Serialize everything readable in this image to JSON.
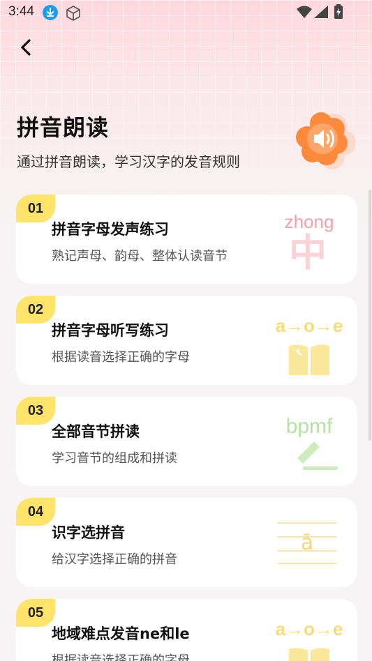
{
  "status_bar": {
    "time": "3:44"
  },
  "header": {
    "title": "拼音朗读",
    "subtitle": "通过拼音朗读，学习汉字的发音规则"
  },
  "cards": [
    {
      "number": "01",
      "title": "拼音字母发声练习",
      "desc": "熟记声母、韵母、整体认读音节",
      "art_word": "zhong",
      "art_char": "中"
    },
    {
      "number": "02",
      "title": "拼音字母听写练习",
      "desc": "根据读音选择正确的字母",
      "art_word": "a→o→e"
    },
    {
      "number": "03",
      "title": "全部音节拼读",
      "desc": "学习音节的组成和拼读",
      "art_word": "bpmf"
    },
    {
      "number": "04",
      "title": "识字选拼音",
      "desc": "给汉字选择正确的拼音",
      "art_word": "ā"
    },
    {
      "number": "05",
      "title": "地域难点发音ne和le",
      "desc": "根据读音选择正确的字母",
      "art_word": "a→o→e"
    }
  ],
  "colors": {
    "accent_yellow": "#ffe36b",
    "card_bg": "#ffffff",
    "speaker_orange": "#fb8a3c"
  }
}
